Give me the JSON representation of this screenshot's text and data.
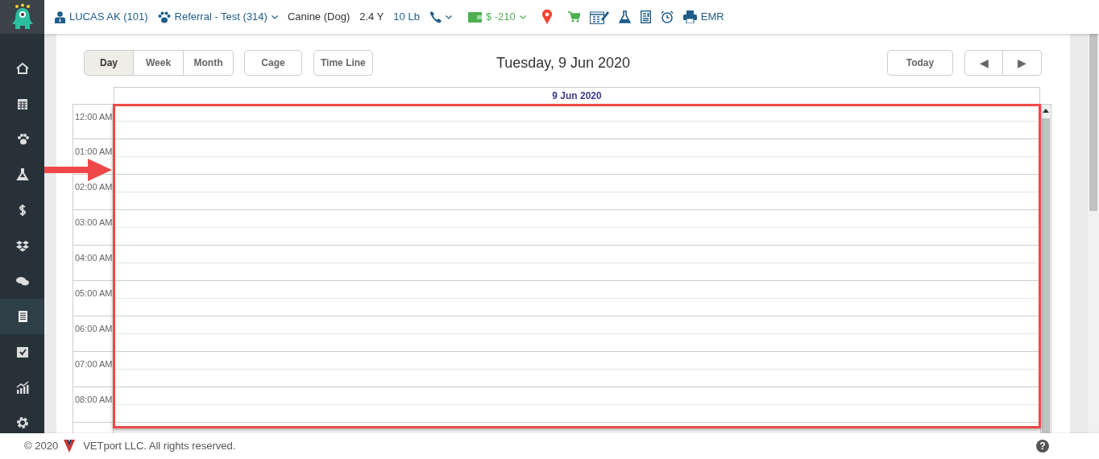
{
  "sidebar": {
    "items": [
      {
        "kind": "home",
        "selected": false
      },
      {
        "kind": "calendar",
        "selected": false
      },
      {
        "kind": "paw",
        "selected": false
      },
      {
        "kind": "flask",
        "selected": false
      },
      {
        "kind": "dollar",
        "selected": false
      },
      {
        "kind": "boxes",
        "selected": false
      },
      {
        "kind": "chat",
        "selected": false
      },
      {
        "kind": "document",
        "selected": true
      },
      {
        "kind": "checkbox",
        "selected": false
      },
      {
        "kind": "chart",
        "selected": false
      },
      {
        "kind": "gear",
        "selected": false
      }
    ]
  },
  "patient_bar": [
    {
      "kind": "owner",
      "text": "LUCAS AK (101)"
    },
    {
      "kind": "patient",
      "text": "Referral - Test (314)"
    },
    {
      "kind": "plain",
      "text": "Canine (Dog)"
    },
    {
      "kind": "plain",
      "text": "2.4 Y"
    },
    {
      "kind": "weight",
      "text": "10 Lb"
    },
    {
      "kind": "phone"
    },
    {
      "kind": "balance",
      "text": "$ -210"
    },
    {
      "kind": "pin"
    },
    {
      "kind": "cart"
    },
    {
      "kind": "calculator"
    },
    {
      "kind": "flask"
    },
    {
      "kind": "document"
    },
    {
      "kind": "alarm"
    },
    {
      "kind": "printer",
      "text": "EMR"
    }
  ],
  "calendar": {
    "views": [
      {
        "label": "Day",
        "selected": true
      },
      {
        "label": "Week",
        "selected": false
      },
      {
        "label": "Month",
        "selected": false
      }
    ],
    "extra_buttons": [
      "Cage",
      "Time Line"
    ],
    "title": "Tuesday, 9 Jun 2020",
    "today": "Today",
    "prev": "◀",
    "next": "▶",
    "day_header": "9 Jun 2020",
    "time_slots": [
      "12:00 AM",
      "01:00 AM",
      "02:00 AM",
      "03:00 AM",
      "04:00 AM",
      "05:00 AM",
      "06:00 AM",
      "07:00 AM",
      "08:00 AM"
    ]
  },
  "footer": {
    "copyright": "© 2020",
    "company": "VETport LLC. All rights reserved.",
    "help": "?"
  }
}
